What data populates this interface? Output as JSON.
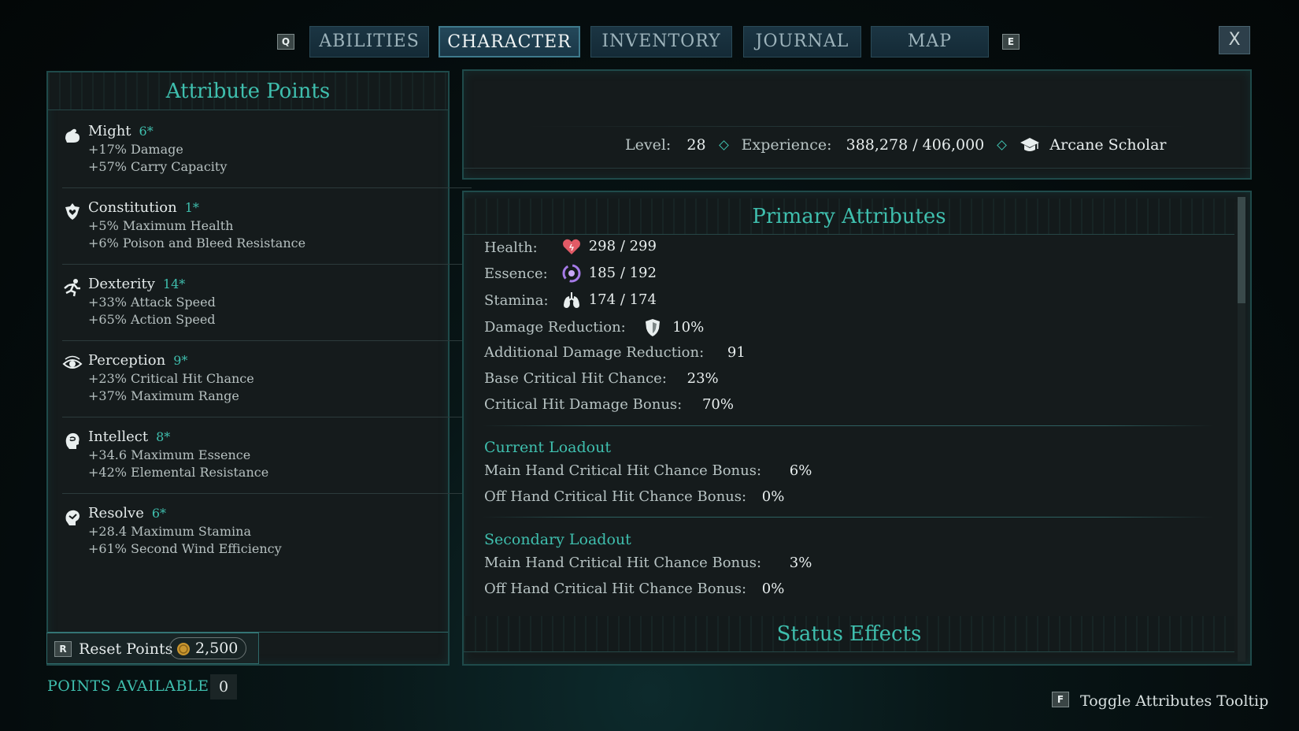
{
  "nav": {
    "prev_key": "Q",
    "next_key": "E",
    "tabs": [
      "ABILITIES",
      "CHARACTER",
      "INVENTORY",
      "JOURNAL",
      "MAP"
    ],
    "active_tab": "CHARACTER",
    "close_label": "X"
  },
  "attributes_panel": {
    "title": "Attribute Points",
    "items": [
      {
        "name": "Might",
        "value": "6*",
        "icon": "fist-icon",
        "lines": [
          "+17% Damage",
          "+57% Carry Capacity"
        ]
      },
      {
        "name": "Constitution",
        "value": "1*",
        "icon": "heart-shield-icon",
        "lines": [
          "+5% Maximum Health",
          "+6% Poison and Bleed Resistance"
        ]
      },
      {
        "name": "Dexterity",
        "value": "14*",
        "icon": "running-figure-icon",
        "lines": [
          "+33% Attack Speed",
          "+65% Action Speed"
        ]
      },
      {
        "name": "Perception",
        "value": "9*",
        "icon": "eye-icon",
        "lines": [
          "+23% Critical Hit Chance",
          "+37% Maximum Range"
        ]
      },
      {
        "name": "Intellect",
        "value": "8*",
        "icon": "head-brain-icon",
        "lines": [
          "+34.6 Maximum Essence",
          "+42% Elemental Resistance"
        ]
      },
      {
        "name": "Resolve",
        "value": "6*",
        "icon": "resolve-icon",
        "lines": [
          "+28.4 Maximum Stamina",
          "+61% Second Wind Efficiency"
        ]
      }
    ],
    "reset": {
      "key": "R",
      "label": "Reset Points",
      "cost": "2,500",
      "icon": "coin-icon"
    },
    "points_available_label": "POINTS AVAILABLE",
    "points_available_value": "0"
  },
  "summary": {
    "level_label": "Level:",
    "level_value": "28",
    "experience_label": "Experience:",
    "experience_value": "388,278 / 406,000",
    "class_name": "Arcane Scholar",
    "class_icon": "graduation-cap-icon"
  },
  "primary_attributes": {
    "title": "Primary Attributes",
    "health_label": "Health:",
    "health_value": "298 / 299",
    "essence_label": "Essence:",
    "essence_value": "185 / 192",
    "stamina_label": "Stamina:",
    "stamina_value": "174 / 174",
    "damage_reduction_label": "Damage Reduction:",
    "damage_reduction_value": "10%",
    "additional_dr_label": "Additional Damage Reduction:",
    "additional_dr_value": "91",
    "base_crit_label": "Base Critical Hit Chance:",
    "base_crit_value": "23%",
    "crit_damage_label": "Critical Hit Damage Bonus:",
    "crit_damage_value": "70%",
    "current_loadout": {
      "title": "Current Loadout",
      "main_label": "Main Hand Critical Hit Chance Bonus:",
      "main_value": "6%",
      "off_label": "Off Hand Critical Hit Chance Bonus:",
      "off_value": "0%"
    },
    "secondary_loadout": {
      "title": "Secondary Loadout",
      "main_label": "Main Hand Critical Hit Chance Bonus:",
      "main_value": "3%",
      "off_label": "Off Hand Critical Hit Chance Bonus:",
      "off_value": "0%"
    },
    "status_effects_title": "Status Effects"
  },
  "footer": {
    "tooltip_key": "F",
    "tooltip_label": "Toggle Attributes Tooltip"
  },
  "colors": {
    "accent": "#3fbfae",
    "panel_bg": "#151b1c",
    "panel_border": "#1f4a4a"
  }
}
